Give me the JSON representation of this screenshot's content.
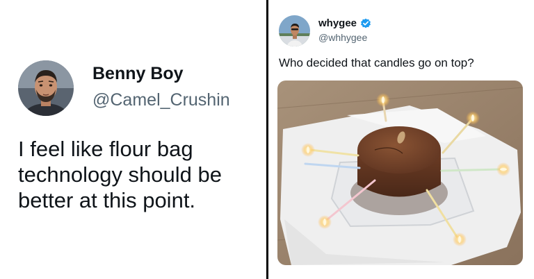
{
  "left_tweet": {
    "author_name": "Benny Boy",
    "author_handle": "@Camel_Crushin",
    "avatar_icon": "profile-photo-bearded-man",
    "text_lines": [
      "I feel like flour bag",
      "technology should be",
      "better at this point."
    ]
  },
  "right_tweet": {
    "author_name": "whygee",
    "author_handle": "@whhygee",
    "avatar_icon": "profile-photo-man-outdoors",
    "verified_icon": "verified-badge-icon",
    "text": "Who decided that candles go on top?",
    "media_icon": "photo-chocolate-cake-candles-sideways"
  },
  "colors": {
    "name": "#0f1419",
    "handle": "#536471",
    "verified": "#1d9bf0",
    "divider": "#000000"
  }
}
